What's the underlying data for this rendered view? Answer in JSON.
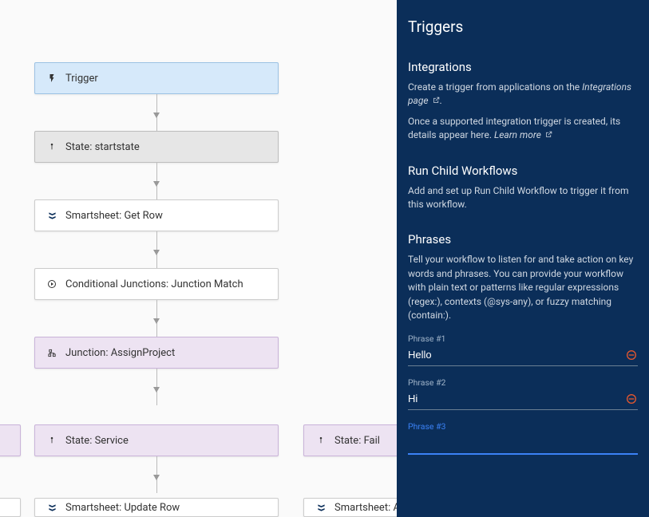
{
  "flow": {
    "trigger": {
      "label": "Trigger"
    },
    "state_start": {
      "label": "State: startstate"
    },
    "smartsheet_get": {
      "label": "Smartsheet: Get Row"
    },
    "cond_junction": {
      "label": "Conditional Junctions: Junction Match"
    },
    "junction_assign": {
      "label": "Junction: AssignProject"
    },
    "state_left": {
      "label": ""
    },
    "state_service": {
      "label": "State: Service"
    },
    "state_fail": {
      "label": "State: Fail"
    },
    "sm_update": {
      "label": "Smartsheet: Update Row"
    },
    "sm_add": {
      "label": "Smartsheet: Add"
    }
  },
  "sidebar": {
    "title": "Triggers",
    "integrations": {
      "heading": "Integrations",
      "line1_pre": "Create a trigger from applications on the ",
      "line1_link": "Integrations page",
      "line2_pre": "Once a supported integration trigger is created, its details appear here. ",
      "line2_link": "Learn more"
    },
    "runchild": {
      "heading": "Run Child Workflows",
      "text": "Add and set up Run Child Workflow to trigger it from this workflow."
    },
    "phrases": {
      "heading": "Phrases",
      "description": "Tell your workflow to listen for and take action on key words and phrases. You can provide your workflow with plain text or patterns like regular expressions (regex:), contexts (@sys-any), or fuzzy matching (contain:).",
      "items": [
        {
          "label": "Phrase #1",
          "value": "Hello"
        },
        {
          "label": "Phrase #2",
          "value": "Hi"
        },
        {
          "label": "Phrase #3",
          "value": ""
        }
      ]
    }
  }
}
